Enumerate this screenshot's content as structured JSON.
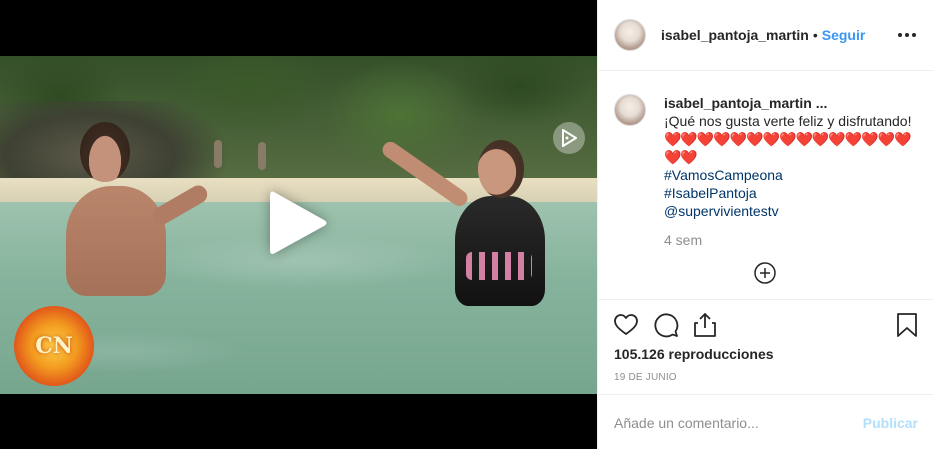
{
  "post": {
    "username": "isabel_pantoja_martin",
    "separator": "•",
    "follow_label": "Seguir"
  },
  "video": {
    "channel_logo_text": "CN"
  },
  "caption": {
    "username": "isabel_pantoja_martin ...",
    "text": "¡Qué nos gusta verte feliz y disfrutando!",
    "hearts": "❤️❤️❤️❤️❤️❤️❤️❤️❤️❤️❤️❤️❤️❤️❤️❤️❤️",
    "hashtags": [
      "#VamosCampeona",
      "#IsabelPantoja",
      "@supervivientestv"
    ],
    "time_ago": "4 sem"
  },
  "stats": {
    "views": "105.126 reproducciones",
    "date": "19 DE JUNIO"
  },
  "comment": {
    "placeholder": "Añade un comentario...",
    "publish_label": "Publicar"
  },
  "icons": [
    "play-icon",
    "heart-icon",
    "comment-icon",
    "share-icon",
    "bookmark-icon",
    "more-options-icon",
    "plus-circle-icon"
  ],
  "colors": {
    "link": "#3897f0",
    "publish_disabled": "#b2dffc",
    "secondary_text": "#8e8e8e",
    "hashtag": "#003569"
  }
}
